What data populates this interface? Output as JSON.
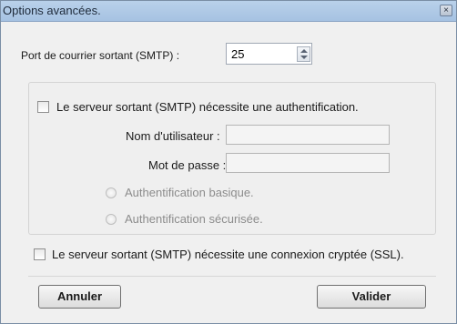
{
  "window": {
    "title": "Options avancées."
  },
  "port": {
    "label": "Port de courrier sortant (SMTP) :",
    "value": "25"
  },
  "auth": {
    "checkbox_label": "Le serveur sortant (SMTP) nécessite une authentification.",
    "checked": false,
    "username_label": "Nom d'utilisateur :",
    "username_value": "",
    "password_label": "Mot de passe :",
    "password_value": "",
    "radio_basic": "Authentification basique.",
    "radio_secure": "Authentification sécurisée."
  },
  "ssl": {
    "checkbox_label": "Le serveur sortant (SMTP) nécessite une connexion cryptée (SSL).",
    "checked": false
  },
  "buttons": {
    "cancel": "Annuler",
    "ok": "Valider"
  }
}
